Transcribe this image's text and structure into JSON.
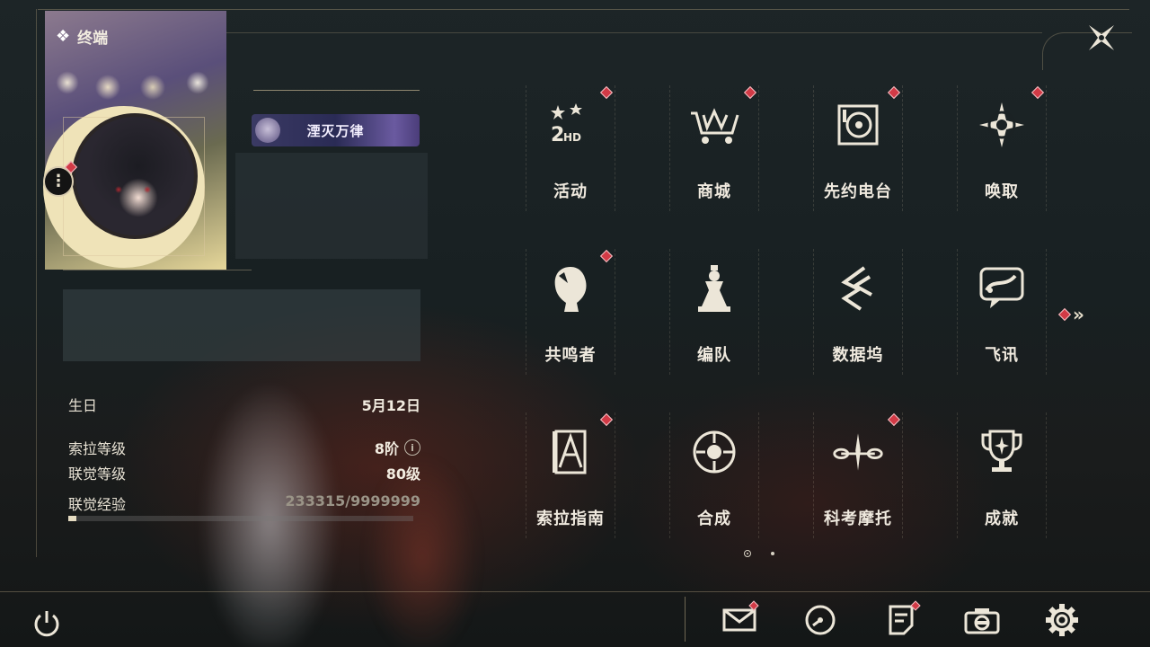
{
  "header": {
    "title": "终端",
    "title_icon": "diamond-cluster-icon",
    "close_icon": "close-x-icon"
  },
  "profile": {
    "title_badge": "湮灭万律",
    "fields": [
      {
        "label": "生日",
        "value": "5月12日"
      },
      {
        "label": "索拉等级",
        "value": "8阶"
      },
      {
        "label": "联觉等级",
        "value": "80级"
      }
    ],
    "exp_label": "联觉经验",
    "exp_value": "233315/9999999",
    "exp_fraction": 0.023
  },
  "menu": {
    "items": [
      {
        "label": "活动",
        "icon": "event-2hd-icon",
        "badge": true
      },
      {
        "label": "商城",
        "icon": "shop-cart-icon",
        "badge": true
      },
      {
        "label": "先约电台",
        "icon": "radio-icon",
        "badge": true
      },
      {
        "label": "唤取",
        "icon": "compass-star-icon",
        "badge": true
      },
      {
        "label": "共鸣者",
        "icon": "resonator-head-icon",
        "badge": true
      },
      {
        "label": "编队",
        "icon": "chess-team-icon",
        "badge": false
      },
      {
        "label": "数据坞",
        "icon": "data-dock-icon",
        "badge": false
      },
      {
        "label": "飞讯",
        "icon": "chat-message-icon",
        "badge": false
      },
      {
        "label": "索拉指南",
        "icon": "guide-book-icon",
        "badge": true
      },
      {
        "label": "合成",
        "icon": "synthesis-icon",
        "badge": false
      },
      {
        "label": "科考摩托",
        "icon": "motorbike-icon",
        "badge": true
      },
      {
        "label": "成就",
        "icon": "trophy-icon",
        "badge": false
      }
    ],
    "next_page_icon": "double-chevron-right-icon",
    "page_count": 2,
    "current_page": 1
  },
  "bottom_bar": {
    "power_icon": "power-icon",
    "buttons": [
      {
        "icon": "mail-icon",
        "badge": true
      },
      {
        "icon": "clock-icon",
        "badge": false
      },
      {
        "icon": "notice-icon",
        "badge": true
      },
      {
        "icon": "camera-icon",
        "badge": false
      },
      {
        "icon": "settings-gear-icon",
        "badge": false
      }
    ]
  },
  "colors": {
    "badge_red": "#d23a46",
    "text": "#f0eadf",
    "background": "#1a2224"
  }
}
